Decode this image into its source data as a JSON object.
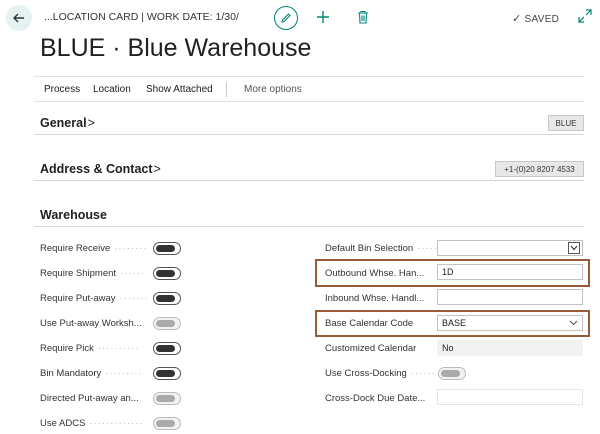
{
  "header": {
    "breadcrumb": "...LOCATION CARD | WORK DATE: 1/30/",
    "saved_label": "SAVED",
    "saved_check": "✓"
  },
  "page_title": "BLUE · Blue Warehouse",
  "actions": {
    "process": "Process",
    "location": "Location",
    "show_attached": "Show Attached",
    "more_options": "More options"
  },
  "general": {
    "title": "General",
    "chevron": ">",
    "promoted_value": "BLUE"
  },
  "address_contact": {
    "title": "Address & Contact",
    "chevron": ">",
    "promoted_value": "+1-(0)20 8207 4533"
  },
  "warehouse": {
    "title": "Warehouse",
    "left_fields": [
      {
        "label": "Require Receive",
        "on": true
      },
      {
        "label": "Require Shipment",
        "on": true
      },
      {
        "label": "Require Put-away",
        "on": true
      },
      {
        "label": "Use Put-away Worksh...",
        "on": false
      },
      {
        "label": "Require Pick",
        "on": true
      },
      {
        "label": "Bin Mandatory",
        "on": true
      },
      {
        "label": "Directed Put-away an...",
        "on": false
      },
      {
        "label": "Use ADCS",
        "on": false
      }
    ],
    "right_fields": {
      "default_bin_selection": {
        "label": "Default Bin Selection",
        "value": ""
      },
      "outbound_whse": {
        "label": "Outbound Whse. Han...",
        "value": "1D"
      },
      "inbound_whse": {
        "label": "Inbound Whse. Handl...",
        "value": ""
      },
      "base_calendar": {
        "label": "Base Calendar Code",
        "value": "BASE"
      },
      "customized_calendar": {
        "label": "Customized Calendar",
        "value": "No"
      },
      "use_cross_docking": {
        "label": "Use Cross-Docking",
        "on": false
      },
      "cross_dock_due_date": {
        "label": "Cross-Dock Due Date...",
        "value": ""
      }
    }
  },
  "colors": {
    "accent": "#00857a",
    "highlight": "#9a5b3a"
  }
}
